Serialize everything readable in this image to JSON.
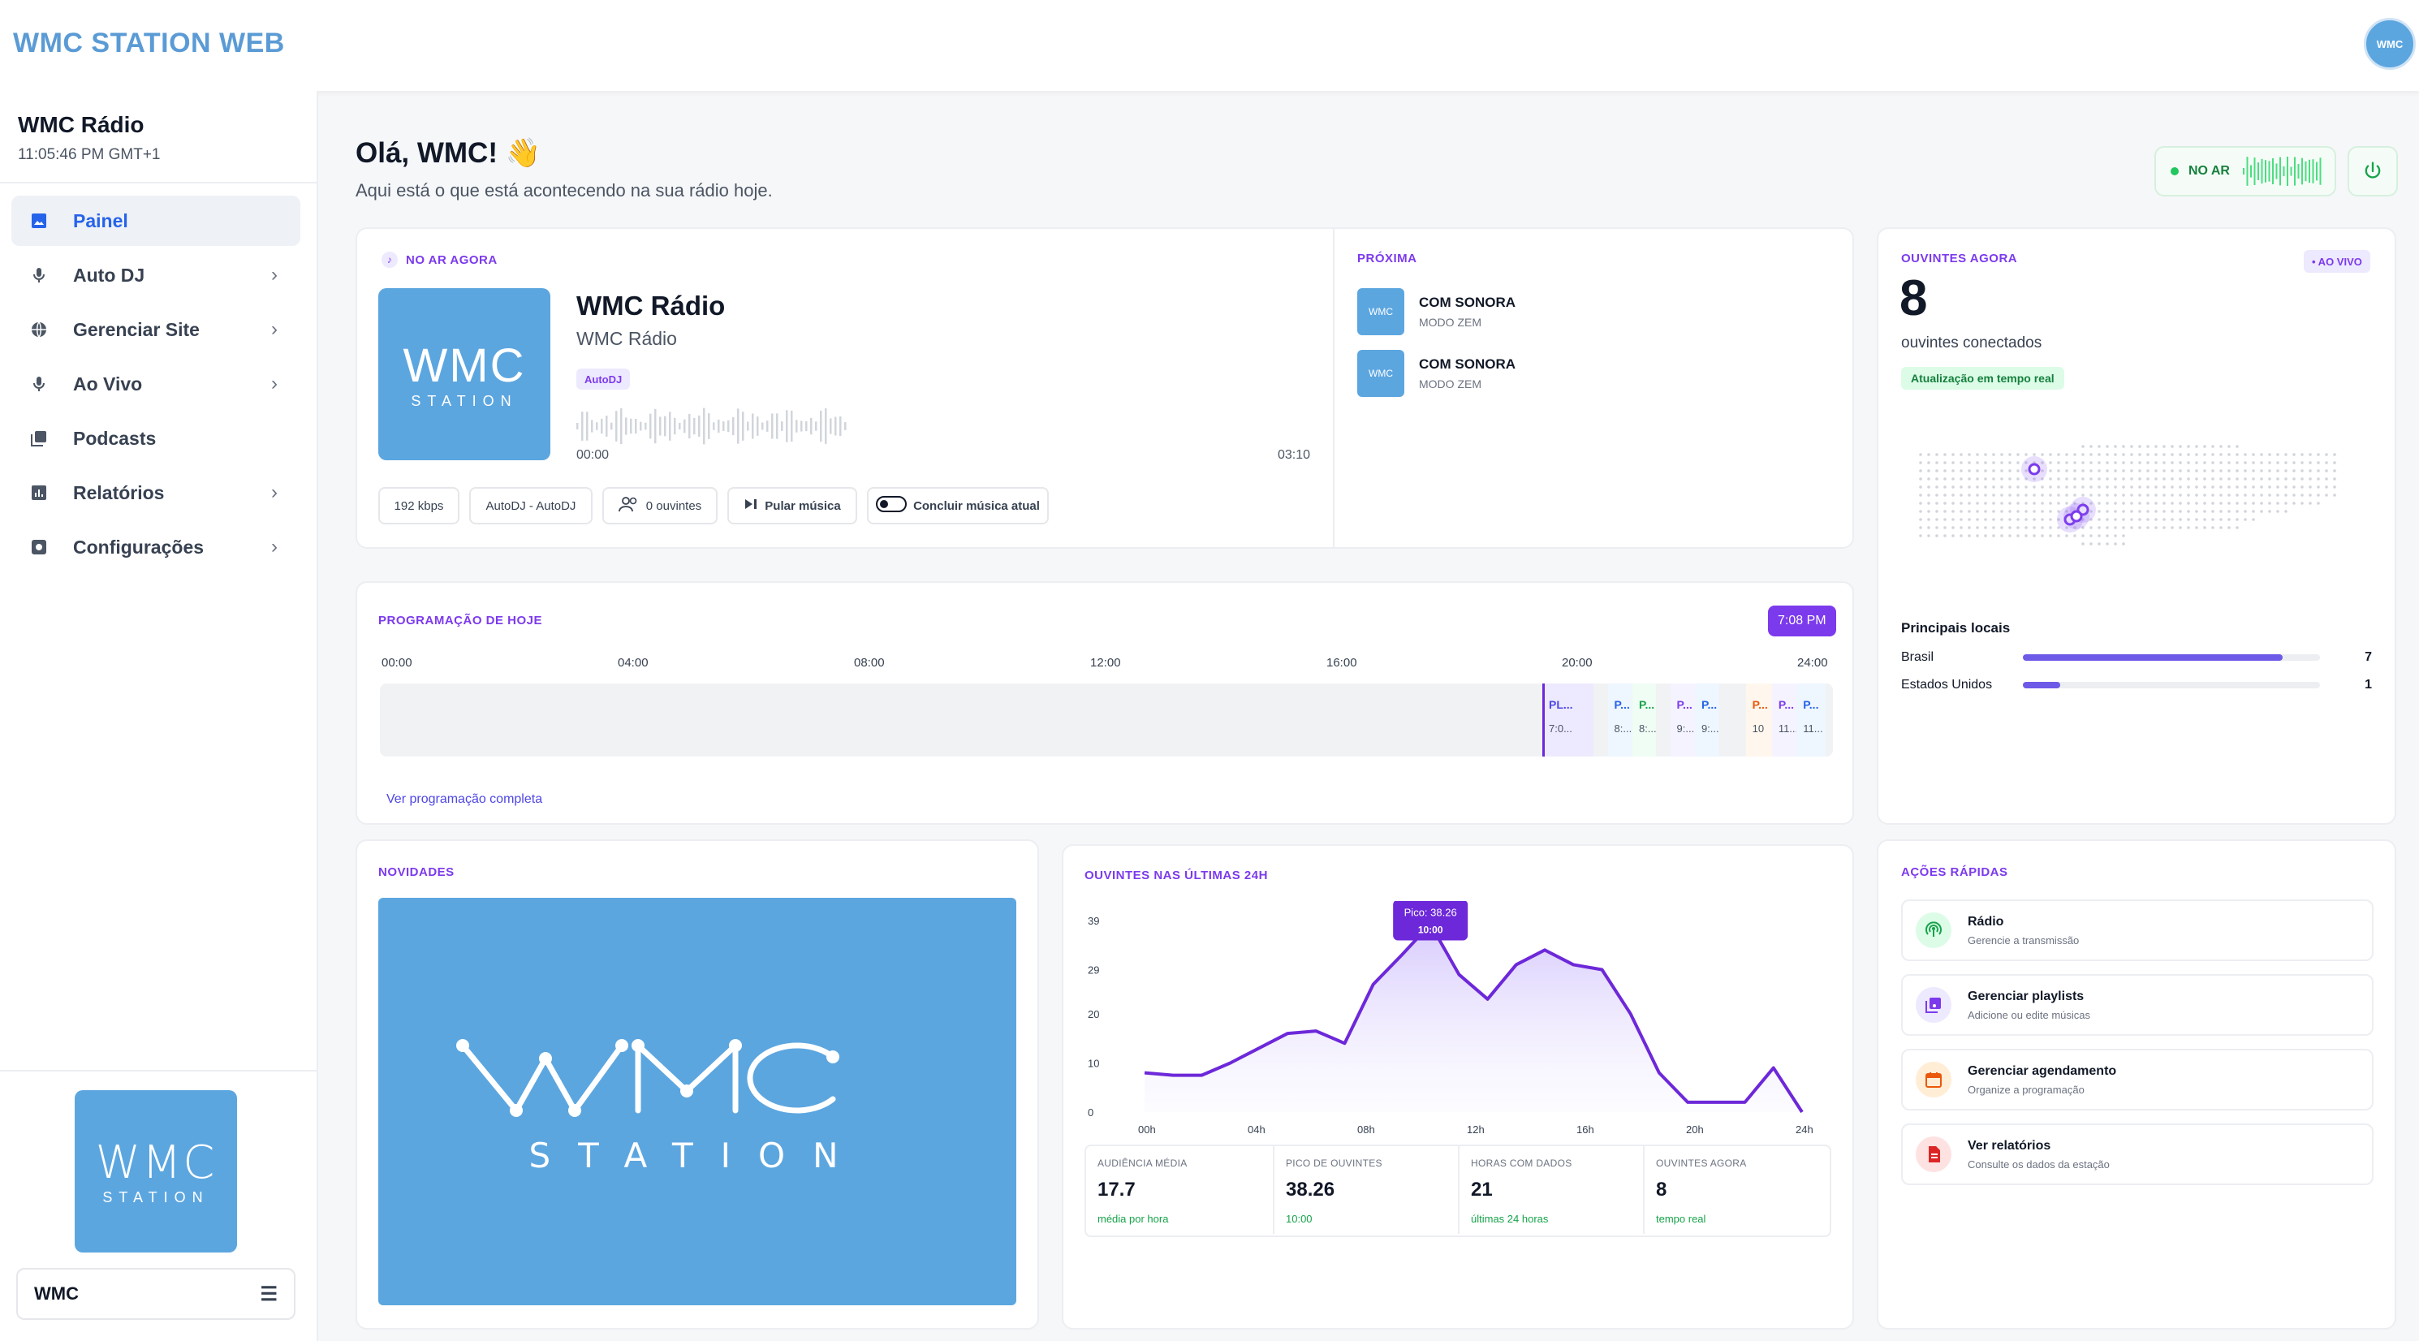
{
  "app": {
    "brand": "WMC STATION WEB",
    "avatar_text": "WMC"
  },
  "sidebar": {
    "station_name": "WMC Rádio",
    "station_time": "11:05:46 PM GMT+1",
    "items": [
      {
        "label": "Painel",
        "icon": "image-icon",
        "active": true,
        "chevron": false
      },
      {
        "label": "Auto DJ",
        "icon": "microphone-icon",
        "chevron": true
      },
      {
        "label": "Gerenciar Site",
        "icon": "globe-icon",
        "chevron": true
      },
      {
        "label": "Ao Vivo",
        "icon": "microphone-icon",
        "chevron": true
      },
      {
        "label": "Podcasts",
        "icon": "library-icon",
        "chevron": false
      },
      {
        "label": "Relatórios",
        "icon": "bar-chart-icon",
        "chevron": true
      },
      {
        "label": "Configurações",
        "icon": "settings-icon",
        "chevron": true
      }
    ],
    "logo": {
      "line1": "WMC",
      "line2": "STATION"
    },
    "user": "WMC"
  },
  "header": {
    "greeting": "Olá, WMC! 👋",
    "subtitle": "Aqui está o que está acontecendo na sua rádio hoje.",
    "onair_label": "NO AR"
  },
  "now_playing": {
    "section": "NO AR AGORA",
    "title": "WMC Rádio",
    "artist": "WMC Rádio",
    "badge": "AutoDJ",
    "time_start": "00:00",
    "time_end": "03:10",
    "art": {
      "line1": "WMC",
      "line2": "STATION"
    },
    "chips": {
      "bitrate": "192 kbps",
      "source": "AutoDJ - AutoDJ",
      "listeners": "0 ouvintes",
      "skip": "Pular música",
      "finish": "Concluir música atual"
    }
  },
  "next": {
    "section": "PRÓXIMA",
    "items": [
      {
        "title": "COM SONORA",
        "subtitle": "MODO ZEM",
        "thumb": "WMC"
      },
      {
        "title": "COM SONORA",
        "subtitle": "MODO ZEM",
        "thumb": "WMC"
      }
    ]
  },
  "listeners_now": {
    "section": "OUVINTES AGORA",
    "live": "• AO VIVO",
    "count": "8",
    "subtitle": "ouvintes conectados",
    "badge": "Atualização em tempo real",
    "locations_title": "Principais locais",
    "locations": [
      {
        "name": "Brasil",
        "count": "7",
        "share": 0.875
      },
      {
        "name": "Estados Unidos",
        "count": "1",
        "share": 0.125
      }
    ]
  },
  "schedule": {
    "section": "PROGRAMAÇÃO DE HOJE",
    "current_time": "7:08 PM",
    "hours": [
      "00:00",
      "04:00",
      "08:00",
      "12:00",
      "16:00",
      "20:00",
      "24:00"
    ],
    "now_fraction": 0.8,
    "slots": [
      {
        "label": "PL...",
        "time": "7:0...",
        "start": 0.8,
        "end": 0.835,
        "bg": "#ede9fe",
        "color": "#4f46e5"
      },
      {
        "label": "P...",
        "time": "8:...",
        "start": 0.845,
        "end": 0.862,
        "bg": "#eef6ff",
        "color": "#2563eb"
      },
      {
        "label": "P...",
        "time": "8:...",
        "start": 0.862,
        "end": 0.878,
        "bg": "#f0fdf4",
        "color": "#16a34a"
      },
      {
        "label": "P...",
        "time": "9:...",
        "start": 0.888,
        "end": 0.905,
        "bg": "#f5f3ff",
        "color": "#7c3aed"
      },
      {
        "label": "P...",
        "time": "9:...",
        "start": 0.905,
        "end": 0.922,
        "bg": "#eef6ff",
        "color": "#2563eb"
      },
      {
        "label": "P...",
        "time": "10",
        "start": 0.94,
        "end": 0.958,
        "bg": "#fff7ed",
        "color": "#ea580c"
      },
      {
        "label": "P...",
        "time": "11...",
        "start": 0.958,
        "end": 0.975,
        "bg": "#f5f3ff",
        "color": "#7c3aed"
      },
      {
        "label": "P...",
        "time": "11...",
        "start": 0.975,
        "end": 0.995,
        "bg": "#eef6ff",
        "color": "#2563eb"
      }
    ],
    "link": "Ver programação completa"
  },
  "news": {
    "section": "NOVIDADES",
    "image": {
      "line1": "WMC",
      "line2": "STATION"
    }
  },
  "chart_data": {
    "type": "area",
    "title": "OUVINTES NAS ÚLTIMAS 24H",
    "x_tick_labels": [
      "00h",
      "04h",
      "08h",
      "12h",
      "16h",
      "20h",
      "24h"
    ],
    "y_tick_labels": [
      "39",
      "29",
      "20",
      "10",
      "0"
    ],
    "ylim": [
      0,
      39
    ],
    "x": [
      0,
      1,
      2,
      3,
      4,
      5,
      6,
      7,
      8,
      9,
      10,
      11,
      12,
      13,
      14,
      15,
      16,
      17,
      18,
      19,
      20,
      21,
      22,
      23
    ],
    "series": [
      {
        "values": [
          8,
          7.5,
          7.5,
          10,
          13,
          16,
          16.5,
          14,
          26,
          32,
          38.26,
          28,
          23,
          30,
          33,
          30,
          29,
          20,
          8,
          2,
          2,
          2,
          9,
          0
        ]
      }
    ],
    "tooltip": {
      "label": "Pico: 38.26",
      "time": "10:00"
    },
    "line_color": "#6d28d9"
  },
  "stats": [
    {
      "label": "AUDIÊNCIA MÉDIA",
      "value": "17.7",
      "sub": "média por hora"
    },
    {
      "label": "PICO DE OUVINTES",
      "value": "38.26",
      "sub": "10:00"
    },
    {
      "label": "HORAS COM DADOS",
      "value": "21",
      "sub": "últimas 24 horas"
    },
    {
      "label": "OUVINTES AGORA",
      "value": "8",
      "sub": "tempo real"
    }
  ],
  "quick_actions": {
    "section": "AÇÕES RÁPIDAS",
    "items": [
      {
        "title": "Rádio",
        "subtitle": "Gerencie a transmissão",
        "icon": "broadcast-icon",
        "bg": "#dcfce7",
        "color": "#16a34a"
      },
      {
        "title": "Gerenciar playlists",
        "subtitle": "Adicione ou edite músicas",
        "icon": "playlist-icon",
        "bg": "#ede9fe",
        "color": "#7c3aed"
      },
      {
        "title": "Gerenciar agendamento",
        "subtitle": "Organize a programação",
        "icon": "calendar-icon",
        "bg": "#ffedd5",
        "color": "#ea580c"
      },
      {
        "title": "Ver relatórios",
        "subtitle": "Consulte os dados da estação",
        "icon": "report-icon",
        "bg": "#fee2e2",
        "color": "#dc2626"
      }
    ]
  }
}
